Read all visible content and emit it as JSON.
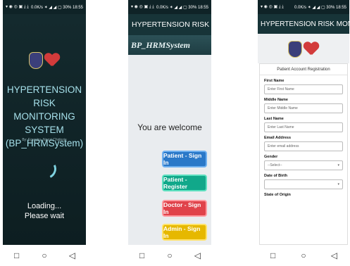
{
  "status": {
    "left": "▾ ◉ ◎ ▣ ⤓ ⤓",
    "right": "0.0K/s ✶ ◢ ◢ ▢ 30% 18:55"
  },
  "nav": {
    "back": "◁",
    "home": "○",
    "recents": "□"
  },
  "splash": {
    "title": "HYPERTENSION RISK MONITORING SYSTEM (BP_HRMSystem)",
    "byline": "By: Egenjiru, Ngozi Chidozie",
    "loading": "Loading...",
    "wait": "Please wait"
  },
  "home": {
    "appbar_title": "HYPERTENSION RISK MONITORI...",
    "subtitle": "BP_HRMSystem",
    "welcome": "You are welcome",
    "buttons": [
      "Patient - Sign In",
      "Patient - Register",
      "Doctor - Sign In",
      "Admin - Sign In"
    ]
  },
  "register": {
    "appbar_title": "HYPERTENSION RISK MONITORI...",
    "card_title": "Patient Account Registration",
    "fields": [
      {
        "label": "First Name",
        "placeholder": "Enter First Name"
      },
      {
        "label": "Middle Name",
        "placeholder": "Enter Middle Name"
      },
      {
        "label": "Last Name",
        "placeholder": "Enter Last Name"
      },
      {
        "label": "Email Address",
        "placeholder": "Enter email address"
      },
      {
        "label": "Gender",
        "placeholder": "--Select--"
      },
      {
        "label": "Date of Birth",
        "placeholder": ""
      }
    ],
    "next_label": "State of Origin"
  },
  "colors": {
    "btn_blue": "#2a78c8",
    "btn_teal": "#11a88a",
    "btn_red": "#e0424a",
    "btn_yellow": "#e6b800"
  }
}
